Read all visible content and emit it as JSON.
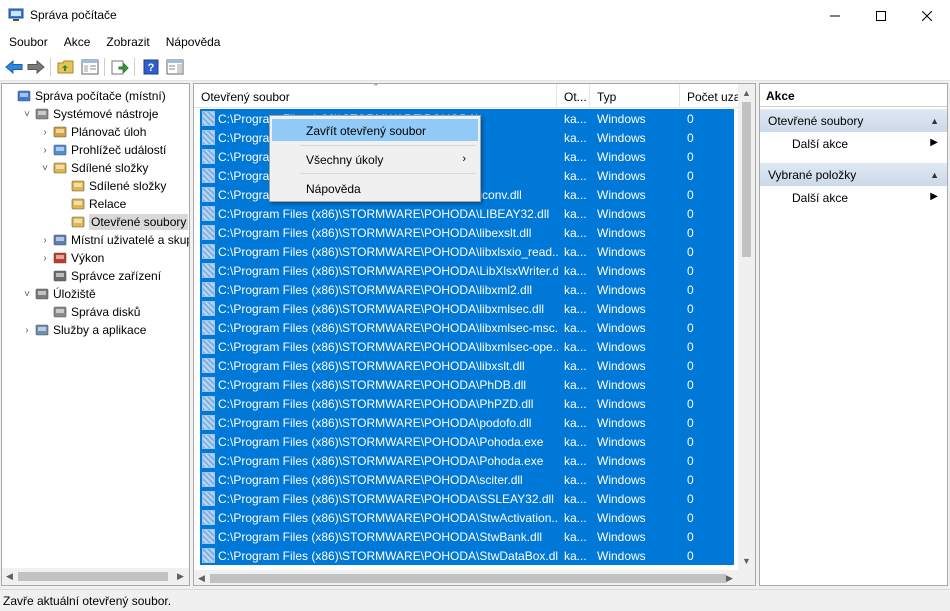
{
  "window": {
    "title": "Správa počítače",
    "controls": {
      "minimize": "—",
      "maximize": "☐",
      "close": "✕"
    }
  },
  "menu": [
    "Soubor",
    "Akce",
    "Zobrazit",
    "Nápověda"
  ],
  "toolbar": {
    "icons": [
      "back-arrow-icon",
      "forward-arrow-icon",
      "up-folder-icon",
      "show-hide-tree-icon",
      "export-list-icon",
      "help-icon",
      "show-hide-action-pane-icon"
    ]
  },
  "tree": {
    "items": [
      {
        "label": "Správa počítače (místní)",
        "level": 0,
        "expander": "",
        "icon": "computer-management-icon"
      },
      {
        "label": "Systémové nástroje",
        "level": 1,
        "expander": "˅",
        "icon": "system-tools-icon"
      },
      {
        "label": "Plánovač úloh",
        "level": 2,
        "expander": "›",
        "icon": "task-scheduler-icon"
      },
      {
        "label": "Prohlížeč událostí",
        "level": 2,
        "expander": "›",
        "icon": "event-viewer-icon"
      },
      {
        "label": "Sdílené složky",
        "level": 2,
        "expander": "˅",
        "icon": "shared-folders-icon"
      },
      {
        "label": "Sdílené složky",
        "level": 3,
        "expander": "",
        "icon": "shares-icon"
      },
      {
        "label": "Relace",
        "level": 3,
        "expander": "",
        "icon": "sessions-icon"
      },
      {
        "label": "Otevřené soubory",
        "level": 3,
        "expander": "",
        "icon": "open-files-icon",
        "selected": true
      },
      {
        "label": "Místní uživatelé a skupiny",
        "level": 2,
        "expander": "›",
        "icon": "local-users-icon"
      },
      {
        "label": "Výkon",
        "level": 2,
        "expander": "›",
        "icon": "performance-icon"
      },
      {
        "label": "Správce zařízení",
        "level": 2,
        "expander": "",
        "icon": "device-manager-icon"
      },
      {
        "label": "Úložiště",
        "level": 1,
        "expander": "˅",
        "icon": "storage-icon"
      },
      {
        "label": "Správa disků",
        "level": 2,
        "expander": "",
        "icon": "disk-management-icon"
      },
      {
        "label": "Služby a aplikace",
        "level": 1,
        "expander": "›",
        "icon": "services-apps-icon"
      }
    ]
  },
  "list": {
    "columns": [
      "Otevřený soubor",
      "Ot...",
      "Typ",
      "Počet uza..."
    ],
    "rows": [
      {
        "file": "C:\\Program Files (x86)\\STORMWARE\\POHODA\\",
        "opened_by": "ka...",
        "type": "Windows",
        "locks": "0"
      },
      {
        "file": "C:\\Program Files (x86)\\STORMWARE\\POHODA\\",
        "opened_by": "ka...",
        "type": "Windows",
        "locks": "0"
      },
      {
        "file": "C:\\Program Files (x86)\\STORMWARE\\POHODA\\",
        "opened_by": "ka...",
        "type": "Windows",
        "locks": "0"
      },
      {
        "file": "C:\\Program Files (x86)\\STORMWARE\\POHODA\\",
        "opened_by": "ka...",
        "type": "Windows",
        "locks": "0"
      },
      {
        "file": "C:\\Program Files (x86)\\STORMWARE\\POHODA\\iconv.dll",
        "opened_by": "ka...",
        "type": "Windows",
        "locks": "0"
      },
      {
        "file": "C:\\Program Files (x86)\\STORMWARE\\POHODA\\LIBEAY32.dll",
        "opened_by": "ka...",
        "type": "Windows",
        "locks": "0"
      },
      {
        "file": "C:\\Program Files (x86)\\STORMWARE\\POHODA\\libexslt.dll",
        "opened_by": "ka...",
        "type": "Windows",
        "locks": "0"
      },
      {
        "file": "C:\\Program Files (x86)\\STORMWARE\\POHODA\\libxlsxio_read....",
        "opened_by": "ka...",
        "type": "Windows",
        "locks": "0"
      },
      {
        "file": "C:\\Program Files (x86)\\STORMWARE\\POHODA\\LibXlsxWriter.dll",
        "opened_by": "ka...",
        "type": "Windows",
        "locks": "0"
      },
      {
        "file": "C:\\Program Files (x86)\\STORMWARE\\POHODA\\libxml2.dll",
        "opened_by": "ka...",
        "type": "Windows",
        "locks": "0"
      },
      {
        "file": "C:\\Program Files (x86)\\STORMWARE\\POHODA\\libxmlsec.dll",
        "opened_by": "ka...",
        "type": "Windows",
        "locks": "0"
      },
      {
        "file": "C:\\Program Files (x86)\\STORMWARE\\POHODA\\libxmlsec-msc...",
        "opened_by": "ka...",
        "type": "Windows",
        "locks": "0"
      },
      {
        "file": "C:\\Program Files (x86)\\STORMWARE\\POHODA\\libxmlsec-ope...",
        "opened_by": "ka...",
        "type": "Windows",
        "locks": "0"
      },
      {
        "file": "C:\\Program Files (x86)\\STORMWARE\\POHODA\\libxslt.dll",
        "opened_by": "ka...",
        "type": "Windows",
        "locks": "0"
      },
      {
        "file": "C:\\Program Files (x86)\\STORMWARE\\POHODA\\PhDB.dll",
        "opened_by": "ka...",
        "type": "Windows",
        "locks": "0"
      },
      {
        "file": "C:\\Program Files (x86)\\STORMWARE\\POHODA\\PhPZD.dll",
        "opened_by": "ka...",
        "type": "Windows",
        "locks": "0"
      },
      {
        "file": "C:\\Program Files (x86)\\STORMWARE\\POHODA\\podofo.dll",
        "opened_by": "ka...",
        "type": "Windows",
        "locks": "0"
      },
      {
        "file": "C:\\Program Files (x86)\\STORMWARE\\POHODA\\Pohoda.exe",
        "opened_by": "ka...",
        "type": "Windows",
        "locks": "0"
      },
      {
        "file": "C:\\Program Files (x86)\\STORMWARE\\POHODA\\Pohoda.exe",
        "opened_by": "ka...",
        "type": "Windows",
        "locks": "0"
      },
      {
        "file": "C:\\Program Files (x86)\\STORMWARE\\POHODA\\sciter.dll",
        "opened_by": "ka...",
        "type": "Windows",
        "locks": "0"
      },
      {
        "file": "C:\\Program Files (x86)\\STORMWARE\\POHODA\\SSLEAY32.dll",
        "opened_by": "ka...",
        "type": "Windows",
        "locks": "0"
      },
      {
        "file": "C:\\Program Files (x86)\\STORMWARE\\POHODA\\StwActivation....",
        "opened_by": "ka...",
        "type": "Windows",
        "locks": "0"
      },
      {
        "file": "C:\\Program Files (x86)\\STORMWARE\\POHODA\\StwBank.dll",
        "opened_by": "ka...",
        "type": "Windows",
        "locks": "0"
      },
      {
        "file": "C:\\Program Files (x86)\\STORMWARE\\POHODA\\StwDataBox.dll",
        "opened_by": "ka...",
        "type": "Windows",
        "locks": "0"
      }
    ],
    "selection_color": "#0078d7"
  },
  "context_menu": {
    "items": [
      {
        "label": "Zavřít otevřený soubor",
        "highlighted": true
      },
      {
        "label": "Všechny úkoly",
        "submenu": "›"
      },
      {
        "label": "Nápověda"
      }
    ]
  },
  "actions": {
    "title": "Akce",
    "sections": [
      {
        "header": "Otevřené soubory",
        "items": [
          {
            "label": "Další akce",
            "chevron": "▶"
          }
        ]
      },
      {
        "header": "Vybrané položky",
        "items": [
          {
            "label": "Další akce",
            "chevron": "▶"
          }
        ]
      }
    ],
    "collapse_glyph": "▲"
  },
  "status": "Zavře aktuální otevřený soubor."
}
